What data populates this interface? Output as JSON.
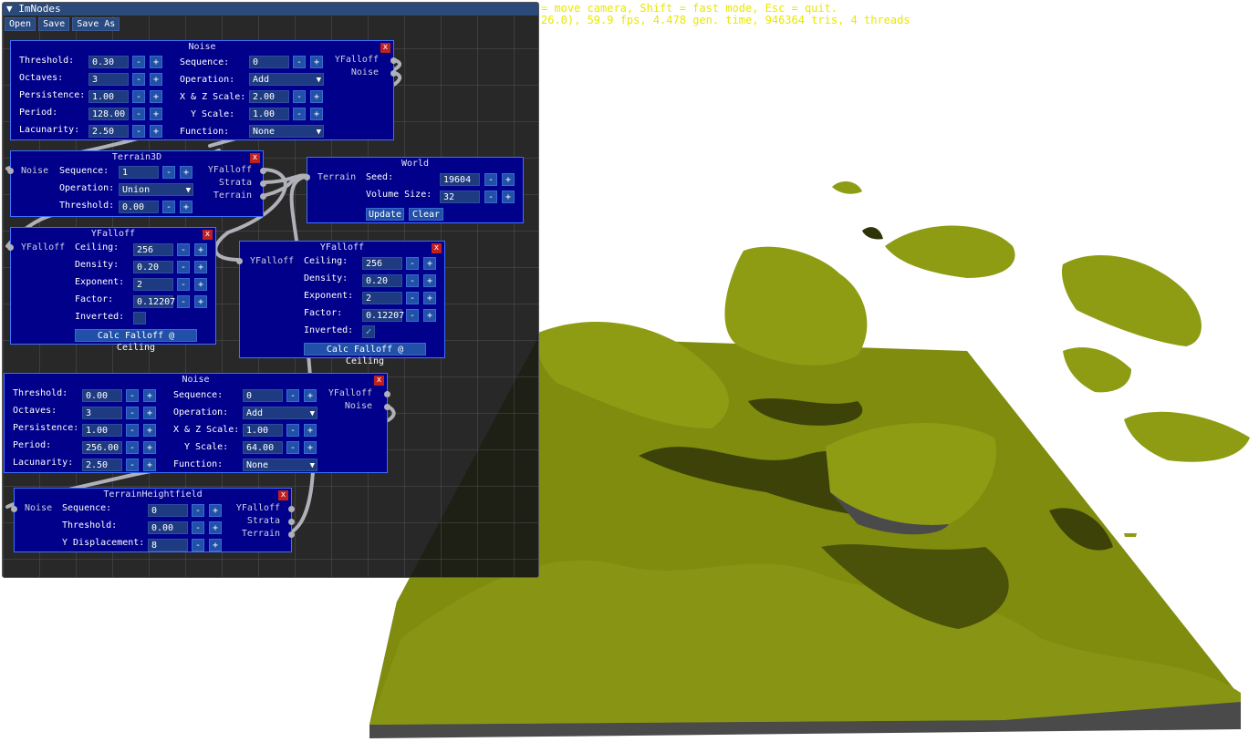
{
  "hud": {
    "line1": "= move camera, Shift = fast mode, Esc = quit.",
    "line2": "26.0), 59.9 fps, 4.478 gen. time, 946364 tris, 4 threads",
    "text_color": "#e8e800"
  },
  "window": {
    "title": "ImNodes",
    "collapse_icon": "triangle-down-icon",
    "menu": [
      "Open",
      "Save",
      "Save As"
    ]
  },
  "colors": {
    "node_bg": "#00008a",
    "node_border": "#4070ff",
    "close_button": "#c02020",
    "link": "#b0b0b8",
    "terrain_top": "#8b9a10",
    "terrain_side": "#555555"
  },
  "nodes": {
    "noise1": {
      "title": "Noise",
      "close": "x",
      "threshold_label": "Threshold:",
      "threshold": "0.30",
      "octaves_label": "Octaves:",
      "octaves": "3",
      "persistence_label": "Persistence:",
      "persistence": "1.00",
      "period_label": "Period:",
      "period": "128.00",
      "lacunarity_label": "Lacunarity:",
      "lacunarity": "2.50",
      "sequence_label": "Sequence:",
      "sequence": "0",
      "operation_label": "Operation:",
      "operation": "Add",
      "xz_label": "X & Z Scale:",
      "xz": "2.00",
      "y_label": "Y   Scale:",
      "y": "1.00",
      "function_label": "Function:",
      "function": "None",
      "out1": "YFalloff",
      "out2": "Noise"
    },
    "terrain3d": {
      "title": "Terrain3D",
      "close": "x",
      "in_noise": "Noise",
      "sequence_label": "Sequence:",
      "sequence": "1",
      "operation_label": "Operation:",
      "operation": "Union",
      "threshold_label": "Threshold:",
      "threshold": "0.00",
      "out1": "YFalloff",
      "out2": "Strata",
      "out3": "Terrain"
    },
    "world": {
      "title": "World",
      "in_terrain": "Terrain",
      "seed_label": "Seed:",
      "seed": "19604",
      "volume_label": "Volume Size:",
      "volume": "32",
      "update": "Update",
      "clear": "Clear"
    },
    "yfalloff1": {
      "title": "YFalloff",
      "close": "x",
      "in": "YFalloff",
      "ceiling_label": "Ceiling:",
      "ceiling": "256",
      "density_label": "Density:",
      "density": "0.20",
      "exponent_label": "Exponent:",
      "exponent": "2",
      "factor_label": "Factor:",
      "factor": "0.12207",
      "inverted_label": "Inverted:",
      "inverted": false,
      "calc": "Calc Falloff @ Ceiling"
    },
    "yfalloff2": {
      "title": "YFalloff",
      "close": "x",
      "in": "YFalloff",
      "ceiling_label": "Ceiling:",
      "ceiling": "256",
      "density_label": "Density:",
      "density": "0.20",
      "exponent_label": "Exponent:",
      "exponent": "2",
      "factor_label": "Factor:",
      "factor": "0.12207",
      "inverted_label": "Inverted:",
      "inverted": true,
      "check_glyph": "✓",
      "calc": "Calc Falloff @ Ceiling"
    },
    "noise2": {
      "title": "Noise",
      "close": "x",
      "threshold_label": "Threshold:",
      "threshold": "0.00",
      "octaves_label": "Octaves:",
      "octaves": "3",
      "persistence_label": "Persistence:",
      "persistence": "1.00",
      "period_label": "Period:",
      "period": "256.00",
      "lacunarity_label": "Lacunarity:",
      "lacunarity": "2.50",
      "sequence_label": "Sequence:",
      "sequence": "0",
      "operation_label": "Operation:",
      "operation": "Add",
      "xz_label": "X & Z Scale:",
      "xz": "1.00",
      "y_label": "Y   Scale:",
      "y": "64.00",
      "function_label": "Function:",
      "function": "None",
      "out1": "YFalloff",
      "out2": "Noise"
    },
    "heightfield": {
      "title": "TerrainHeightfield",
      "close": "x",
      "in_noise": "Noise",
      "sequence_label": "Sequence:",
      "sequence": "0",
      "threshold_label": "Threshold:",
      "threshold": "0.00",
      "ydisp_label": "Y Displacement:",
      "ydisp": "8",
      "out1": "YFalloff",
      "out2": "Strata",
      "out3": "Terrain"
    }
  },
  "stepper": {
    "minus": "-",
    "plus": "+"
  },
  "dropdown_arrow": "▼"
}
